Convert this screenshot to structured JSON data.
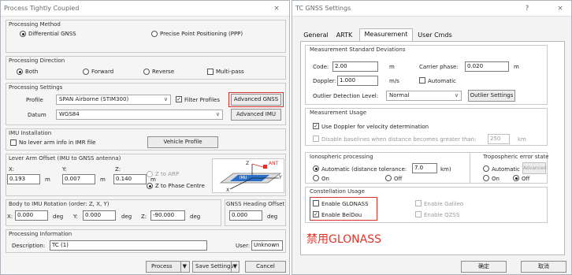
{
  "left": {
    "title": "Process Tightly Coupled",
    "close": "×",
    "method": {
      "title": "Processing Method",
      "opt1": "Differential GNSS",
      "opt2": "Precise Point Positioning (PPP)"
    },
    "direction": {
      "title": "Processing Direction",
      "both": "Both",
      "forward": "Forward",
      "reverse": "Reverse",
      "multipass": "Multi-pass"
    },
    "settings": {
      "title": "Processing Settings",
      "profile_label": "Profile",
      "profile_value": "SPAN Airborne (STIM300)",
      "filter": "Filter Profiles",
      "adv_gnss": "Advanced GNSS",
      "datum_label": "Datum",
      "datum_value": "WGS84",
      "adv_imu": "Advanced IMU"
    },
    "imu": {
      "title": "IMU Installation",
      "no_lever": "No lever arm info in IMR file",
      "vehicle": "Vehicle Profile"
    },
    "lever": {
      "title": "Lever Arm Offset (IMU to GNSS antenna)",
      "x_label": "X:",
      "y_label": "Y:",
      "z_label": "Z:",
      "x": "0.193",
      "y": "0.007",
      "z": "0.140",
      "unit": "m",
      "arp": "Z to ARP",
      "phase": "Z to Phase Centre"
    },
    "diagram": {
      "z": "Z",
      "ant": "ANT",
      "imu": "IMU",
      "y": "Y",
      "x": "X"
    },
    "rotation": {
      "title": "Body to IMU Rotation (order: Z, X, Y)",
      "x_label": "X:",
      "y_label": "Y:",
      "z_label": "Z:",
      "x": "0.000",
      "y": "0.000",
      "z": "-90.000",
      "unit": "deg",
      "heading_title": "GNSS Heading Offset",
      "heading": "0.000"
    },
    "info": {
      "title": "Processing Information",
      "desc_label": "Description:",
      "desc": "TC (1)",
      "user_label": "User:",
      "user": "Unknown"
    },
    "footer": {
      "process": "Process",
      "save": "Save Settings",
      "cancel": "Cancel",
      "arrow": "▼"
    }
  },
  "right": {
    "title": "TC GNSS Settings",
    "help": "?",
    "close": "×",
    "tabs": [
      "General",
      "ARTK",
      "Measurement",
      "User Cmds"
    ],
    "std": {
      "title": "Measurement Standard Deviations",
      "code_label": "Code:",
      "code": "2.00",
      "code_unit": "m",
      "carrier_label": "Carrier phase:",
      "carrier": "0.020",
      "carrier_unit": "m",
      "doppler_label": "Doppler:",
      "doppler": "1.000",
      "doppler_unit": "m/s",
      "automatic": "Automatic",
      "outlier_label": "Outlier Detection Level:",
      "outlier": "Normal",
      "outlier_btn": "Outlier Settings"
    },
    "usage": {
      "title": "Measurement Usage",
      "use_doppler": "Use Doppler for velocity determination",
      "disable_base": "Disable baselines when distance becomes greater than:",
      "dist": "250",
      "dist_unit": "km"
    },
    "iono": {
      "title": "Ionospheric processing",
      "auto": "Automatic (distance tolerance:",
      "tol": "7.0",
      "tol_unit": "km)",
      "on": "On",
      "off": "Off"
    },
    "tropo": {
      "title": "Tropospheric error state",
      "auto": "Automatic",
      "advanced": "Advanced",
      "on": "On",
      "off": "Off"
    },
    "constellation": {
      "title": "Constellation Usage",
      "glonass": "Enable GLONASS",
      "galileo": "Enable Galileo",
      "beidou": "Enable BeiDou",
      "qzss": "Enable QZSS"
    },
    "annotation": "禁用GLONASS",
    "ok": "确定",
    "cancel": "取消"
  },
  "colors": {
    "annotation_red": "#e0352b",
    "highlight_red": "#d9302a",
    "blue_accent": "#2a6fc9"
  }
}
